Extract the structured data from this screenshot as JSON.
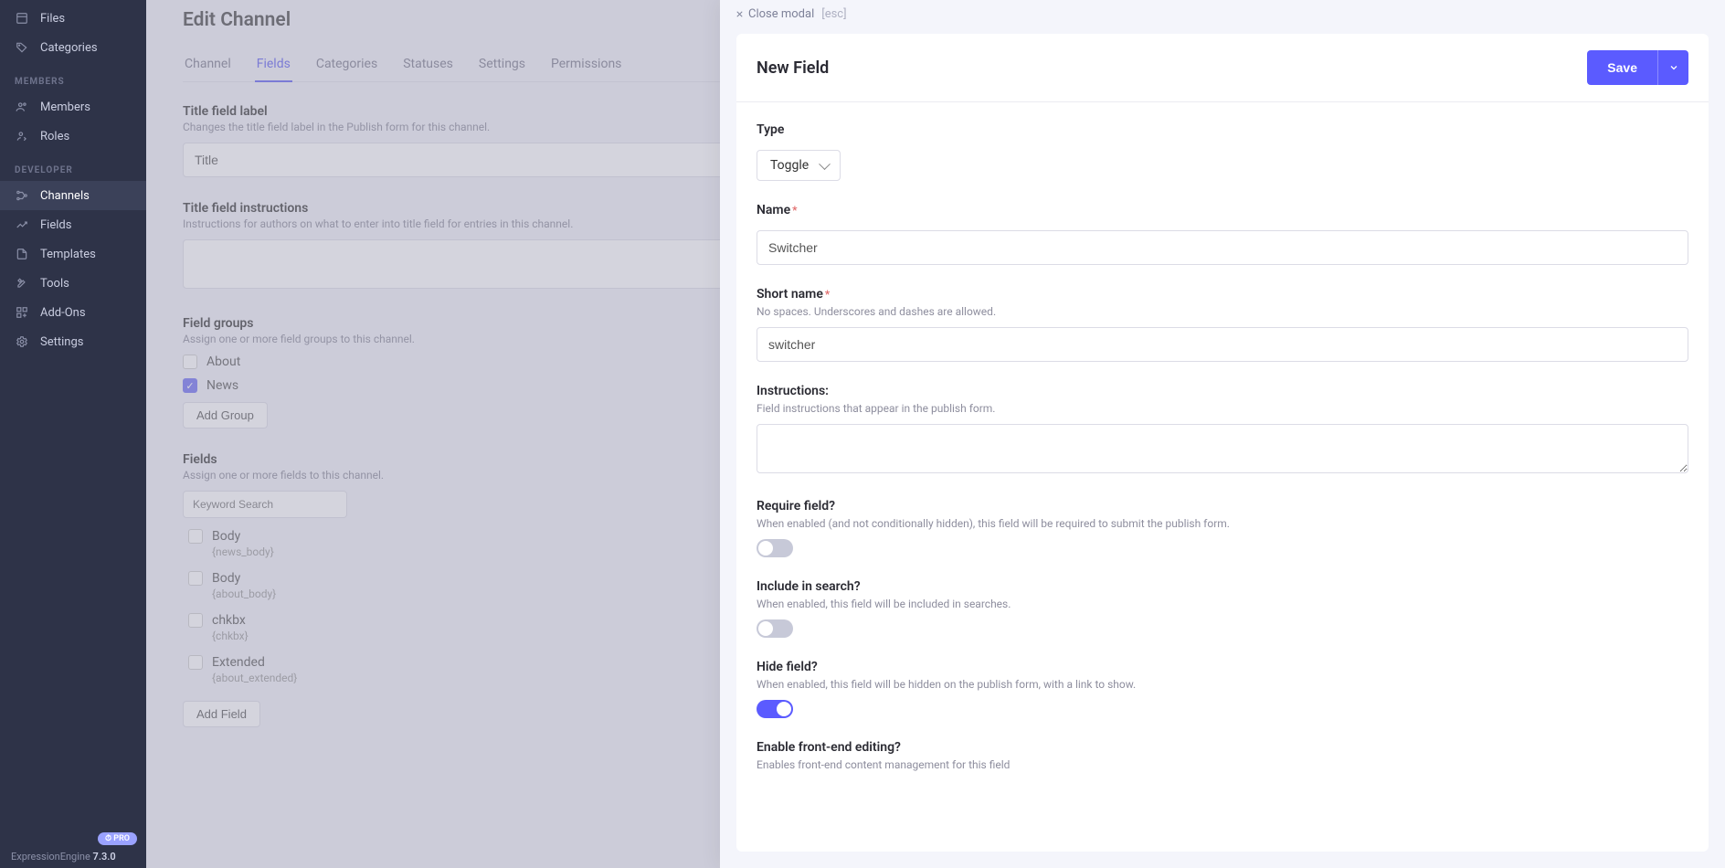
{
  "sidebar": {
    "top_items": [
      {
        "label": "Files",
        "icon": "files"
      },
      {
        "label": "Categories",
        "icon": "tag"
      }
    ],
    "sections": [
      {
        "header": "MEMBERS",
        "items": [
          {
            "label": "Members",
            "icon": "users"
          },
          {
            "label": "Roles",
            "icon": "user-role"
          }
        ]
      },
      {
        "header": "DEVELOPER",
        "items": [
          {
            "label": "Channels",
            "icon": "channels",
            "active": true
          },
          {
            "label": "Fields",
            "icon": "fields"
          },
          {
            "label": "Templates",
            "icon": "templates"
          },
          {
            "label": "Tools",
            "icon": "tools"
          },
          {
            "label": "Add-Ons",
            "icon": "addons"
          },
          {
            "label": "Settings",
            "icon": "gear"
          }
        ]
      }
    ],
    "pro_badge": "⏱ PRO",
    "version_prefix": "ExpressionEngine ",
    "version": "7.3.0"
  },
  "page": {
    "title": "Edit Channel",
    "tabs": [
      "Channel",
      "Fields",
      "Categories",
      "Statuses",
      "Settings",
      "Permissions"
    ],
    "active_tab": 1,
    "title_field": {
      "label": "Title field label",
      "desc": "Changes the title field label in the Publish form for this channel.",
      "value": "Title"
    },
    "title_instr": {
      "label": "Title field instructions",
      "desc": "Instructions for authors on what to enter into title field for entries in this channel.",
      "value": ""
    },
    "field_groups": {
      "label": "Field groups",
      "desc": "Assign one or more field groups to this channel.",
      "options": [
        {
          "label": "About",
          "checked": false
        },
        {
          "label": "News",
          "checked": true
        }
      ],
      "add_btn": "Add Group"
    },
    "fields": {
      "label": "Fields",
      "desc": "Assign one or more fields to this channel.",
      "search_placeholder": "Keyword Search",
      "options": [
        {
          "name": "Body",
          "short": "{news_body}",
          "checked": false
        },
        {
          "name": "Body",
          "short": "{about_body}",
          "checked": false
        },
        {
          "name": "chkbx",
          "short": "{chkbx}",
          "checked": false
        },
        {
          "name": "Extended",
          "short": "{about_extended}",
          "checked": false
        }
      ],
      "add_btn": "Add Field"
    }
  },
  "panel": {
    "close_label": "Close modal",
    "esc_hint": "[esc]",
    "title": "New Field",
    "save_label": "Save",
    "type": {
      "label": "Type",
      "value": "Toggle"
    },
    "name": {
      "label": "Name",
      "value": "Switcher",
      "required": true
    },
    "short_name": {
      "label": "Short name",
      "desc": "No spaces. Underscores and dashes are allowed.",
      "value": "switcher",
      "required": true
    },
    "instructions": {
      "label": "Instructions:",
      "desc": "Field instructions that appear in the publish form.",
      "value": ""
    },
    "require": {
      "label": "Require field?",
      "desc": "When enabled (and not conditionally hidden), this field will be required to submit the publish form.",
      "on": false
    },
    "search": {
      "label": "Include in search?",
      "desc": "When enabled, this field will be included in searches.",
      "on": false
    },
    "hide": {
      "label": "Hide field?",
      "desc": "When enabled, this field will be hidden on the publish form, with a link to show.",
      "on": true
    },
    "frontend": {
      "label": "Enable front-end editing?",
      "desc": "Enables front-end content management for this field"
    }
  }
}
